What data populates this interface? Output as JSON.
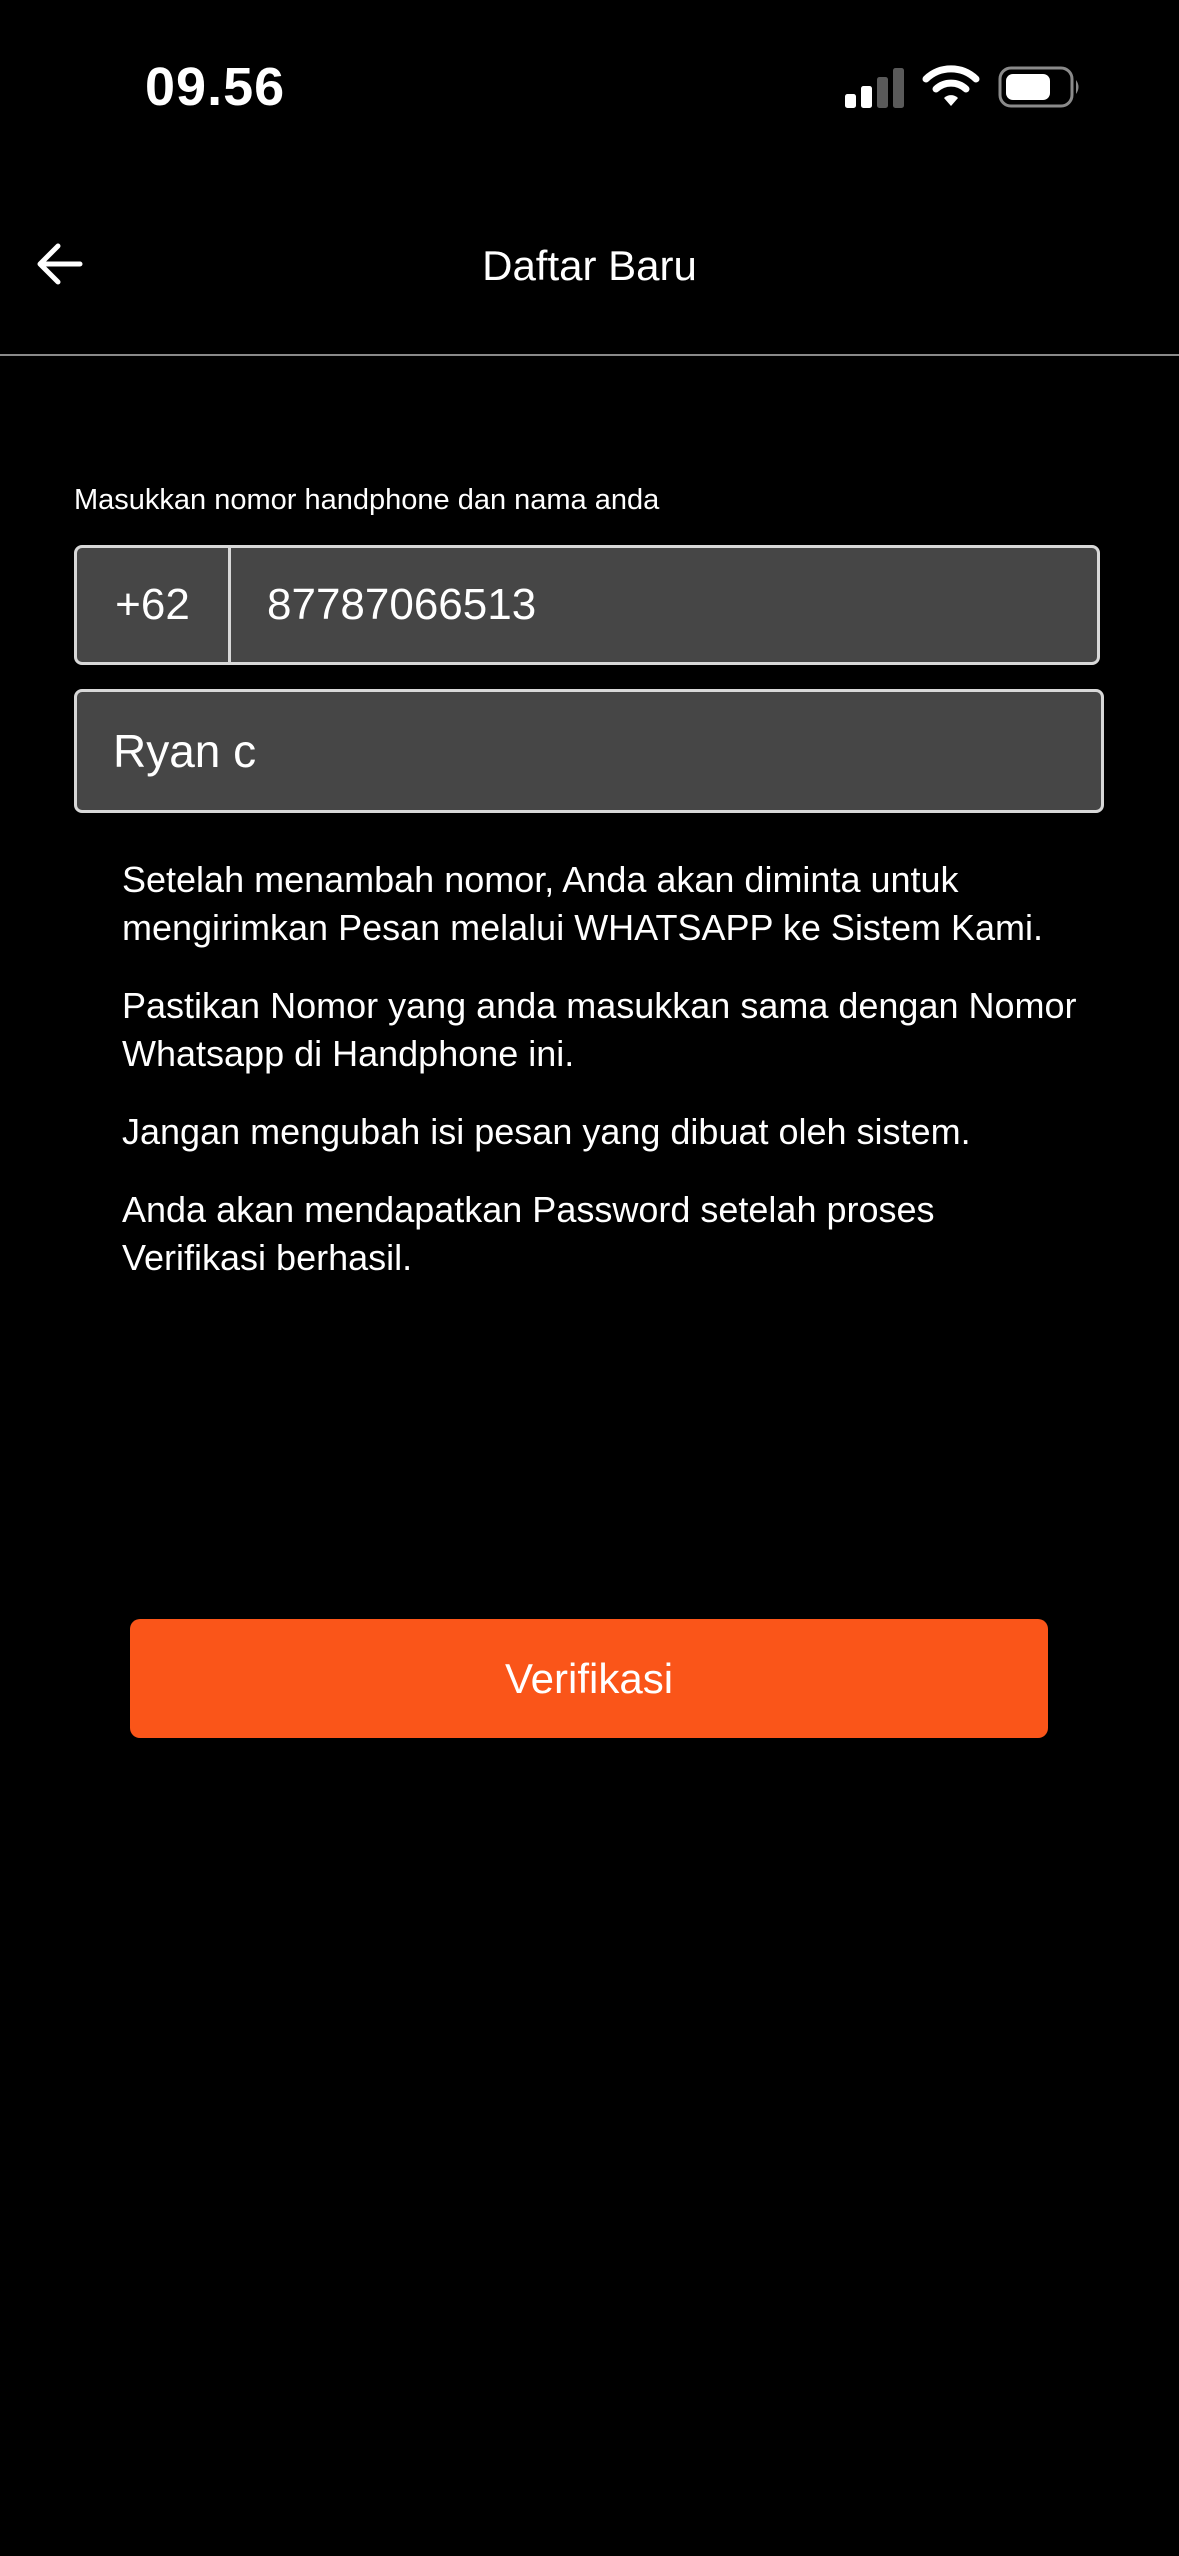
{
  "status_bar": {
    "time": "09.56",
    "icons": [
      "signal-icon",
      "wifi-icon",
      "battery-icon"
    ]
  },
  "nav": {
    "title": "Daftar Baru",
    "back_icon": "arrow-left-icon"
  },
  "form": {
    "label": "Masukkan nomor handphone dan nama anda",
    "country_code": "+62",
    "phone_value": "87787066513",
    "name_value": "Ryan c"
  },
  "info": [
    "Setelah menambah nomor, Anda akan diminta untuk mengirimkan Pesan melalui WHATSAPP ke Sistem Kami.",
    "Pastikan Nomor yang anda masukkan sama dengan Nomor Whatsapp di Handphone ini.",
    "Jangan mengubah isi pesan yang dibuat oleh sistem.",
    "Anda akan mendapatkan Password setelah proses Verifikasi berhasil."
  ],
  "actions": {
    "verify_label": "Verifikasi"
  },
  "colors": {
    "background": "#000000",
    "field_background": "#464646",
    "field_border": "#d8d8d8",
    "accent": "#fa5519",
    "divider": "#8a8a8a"
  }
}
